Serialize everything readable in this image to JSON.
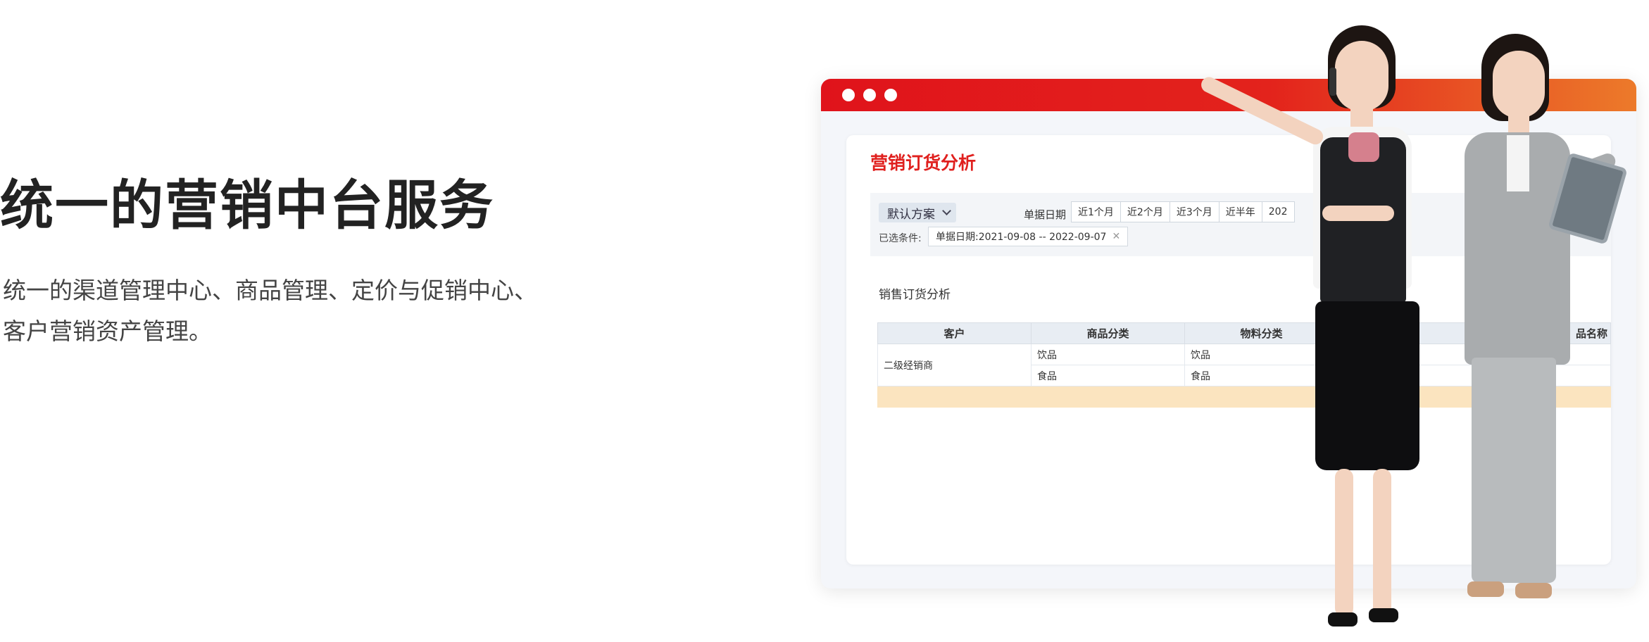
{
  "hero": {
    "title": "统一的营销中台服务",
    "description": "统一的渠道管理中心、商品管理、定价与促销中心、客户营销资产管理。"
  },
  "app": {
    "title": "营销订货分析",
    "scheme_select": "默认方案",
    "date_label": "单据日期",
    "range_buttons": [
      "近1个月",
      "近2个月",
      "近3个月",
      "近半年"
    ],
    "range_partial": "202",
    "conditions_label": "已选条件:",
    "condition_tag": "单据日期:2021-09-08 -- 2022-09-07",
    "section_title": "销售订货分析",
    "table": {
      "columns": [
        "客户",
        "商品分类",
        "物料分类",
        "品名称"
      ],
      "customer": "二级经销商",
      "rows": [
        [
          "饮品",
          "饮品"
        ],
        [
          "食品",
          "食品"
        ]
      ]
    }
  },
  "colors": {
    "accent_red": "#e0201e",
    "bar_gradient_end": "#ec7a2a",
    "total_row": "#fbe4bf"
  }
}
